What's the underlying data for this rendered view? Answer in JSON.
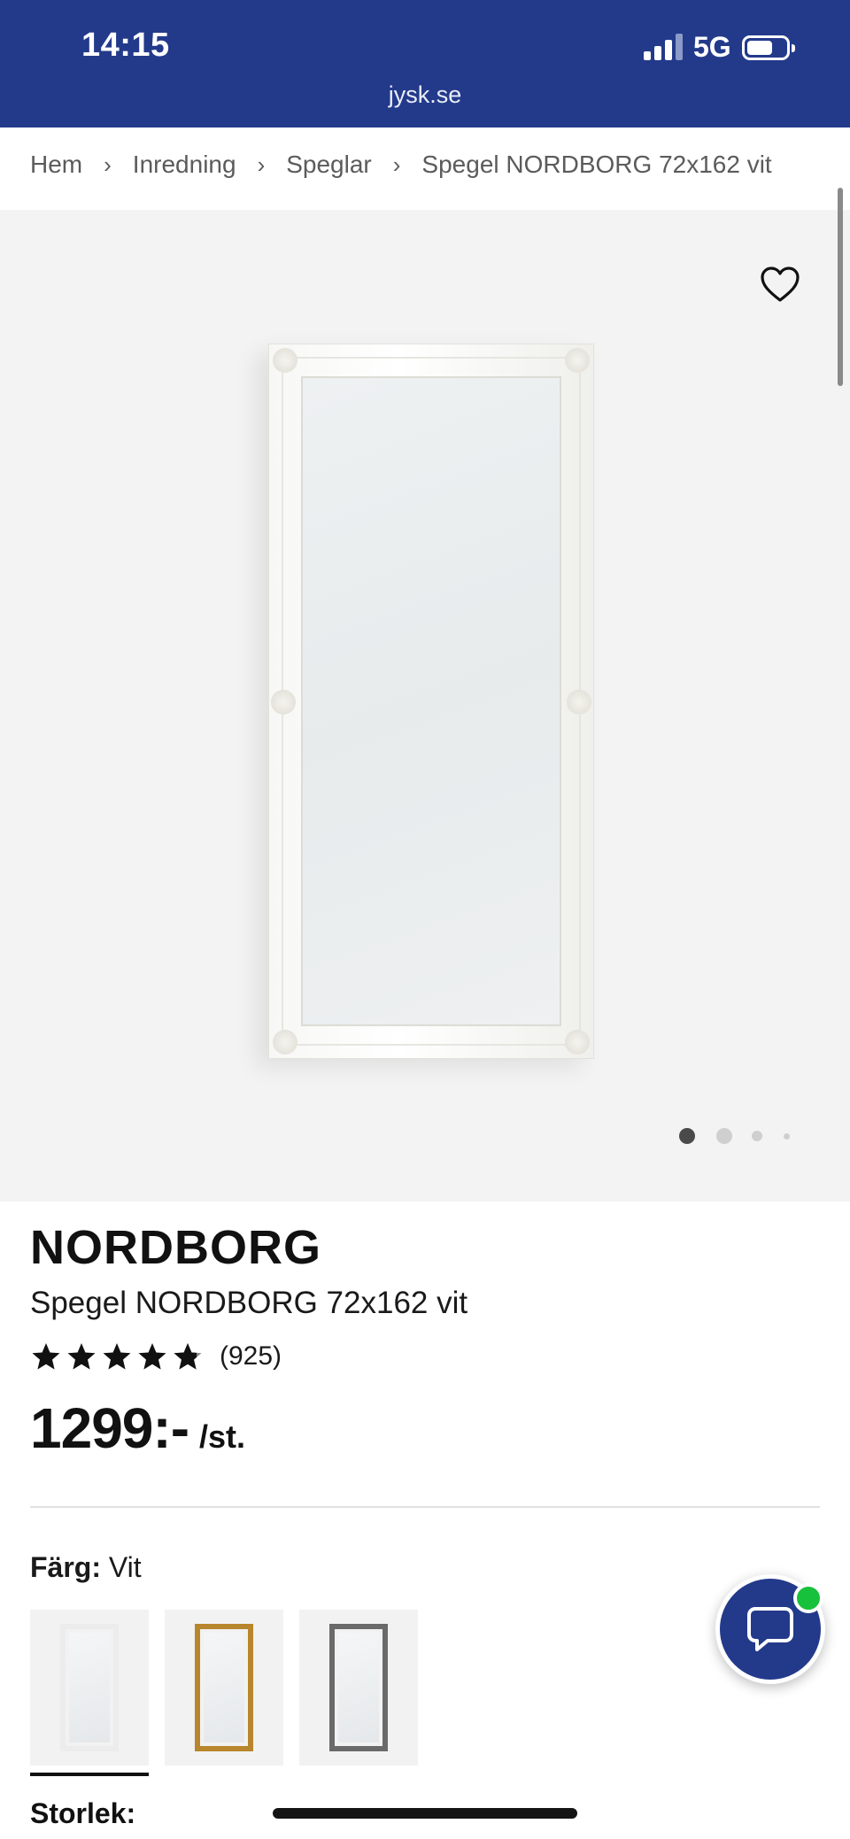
{
  "status_bar": {
    "time": "14:15",
    "network": "5G",
    "icons": [
      "signal-icon",
      "battery-icon"
    ]
  },
  "browser": {
    "url": "jysk.se"
  },
  "breadcrumb": {
    "items": [
      "Hem",
      "Inredning",
      "Speglar",
      "Spegel NORDBORG 72x162 vit"
    ],
    "separator": "›"
  },
  "gallery": {
    "image_count": 4,
    "active_index": 0,
    "favorite_icon": "heart-icon"
  },
  "product": {
    "brand": "NORDBORG",
    "name": "Spegel NORDBORG 72x162 vit",
    "rating": {
      "stars": 4.7,
      "max": 5,
      "count": "(925)"
    },
    "price": {
      "amount": "1299:-",
      "unit": "/st."
    }
  },
  "color": {
    "label": "Färg:",
    "value": "Vit",
    "options": [
      {
        "name": "Vit",
        "frame_color": "#efefef",
        "selected": true
      },
      {
        "name": "Guld",
        "frame_color": "#b8862c",
        "selected": false
      },
      {
        "name": "Grå",
        "frame_color": "#6a6a6a",
        "selected": false
      }
    ]
  },
  "size": {
    "label": "Storlek:"
  },
  "chat": {
    "icon": "chat-bubble-icon",
    "status_color": "#17c13b"
  },
  "colors": {
    "brand_blue": "#233a8b",
    "background_gray": "#f3f3f3"
  }
}
